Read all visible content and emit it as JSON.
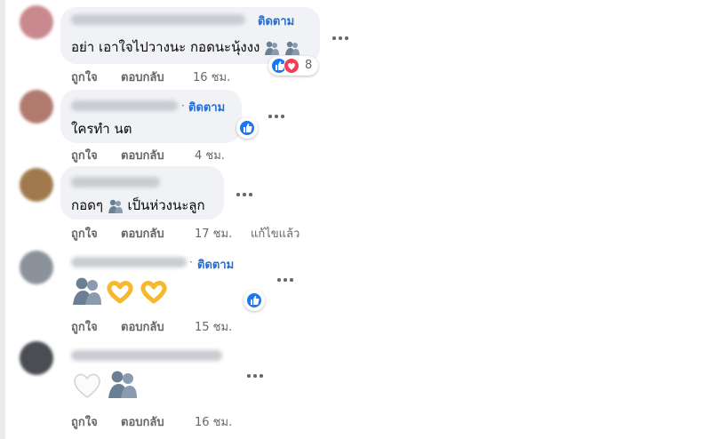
{
  "colors": {
    "follow": "#216fdb",
    "bubble": "#f0f2f5",
    "meta": "#65676b",
    "like": "#1877f2",
    "love": "#f33e58"
  },
  "comments": [
    {
      "follow_label": "ติดตาม",
      "text": "อย่า เอาใจไปวางนะ กอดนะนุ้งงง",
      "like_label": "ถูกใจ",
      "reply_label": "ตอบกลับ",
      "time": "16 ชม.",
      "reaction_count": "8",
      "reactions": [
        "like-icon",
        "love-icon"
      ]
    },
    {
      "follow_label": "ติดตาม",
      "text": "ใครทำ นต",
      "like_label": "ถูกใจ",
      "reply_label": "ตอบกลับ",
      "time": "4 ชม.",
      "reactions": [
        "like-icon"
      ]
    },
    {
      "text": "กอดๆ",
      "text_after": "เป็นห่วงนะลูก",
      "like_label": "ถูกใจ",
      "reply_label": "ตอบกลับ",
      "time": "17 ชม.",
      "edited_label": "แก้ไขแล้ว"
    },
    {
      "follow_label": "ติดตาม",
      "emojis": [
        "hug-emoji",
        "heart-hands-emoji",
        "heart-hands-emoji"
      ],
      "like_label": "ถูกใจ",
      "reply_label": "ตอบกลับ",
      "time": "15 ชม.",
      "reactions": [
        "like-icon"
      ]
    },
    {
      "emojis": [
        "white-heart-emoji",
        "hug-emoji"
      ],
      "like_label": "ถูกใจ",
      "reply_label": "ตอบกลับ",
      "time": "16 ชม."
    }
  ]
}
